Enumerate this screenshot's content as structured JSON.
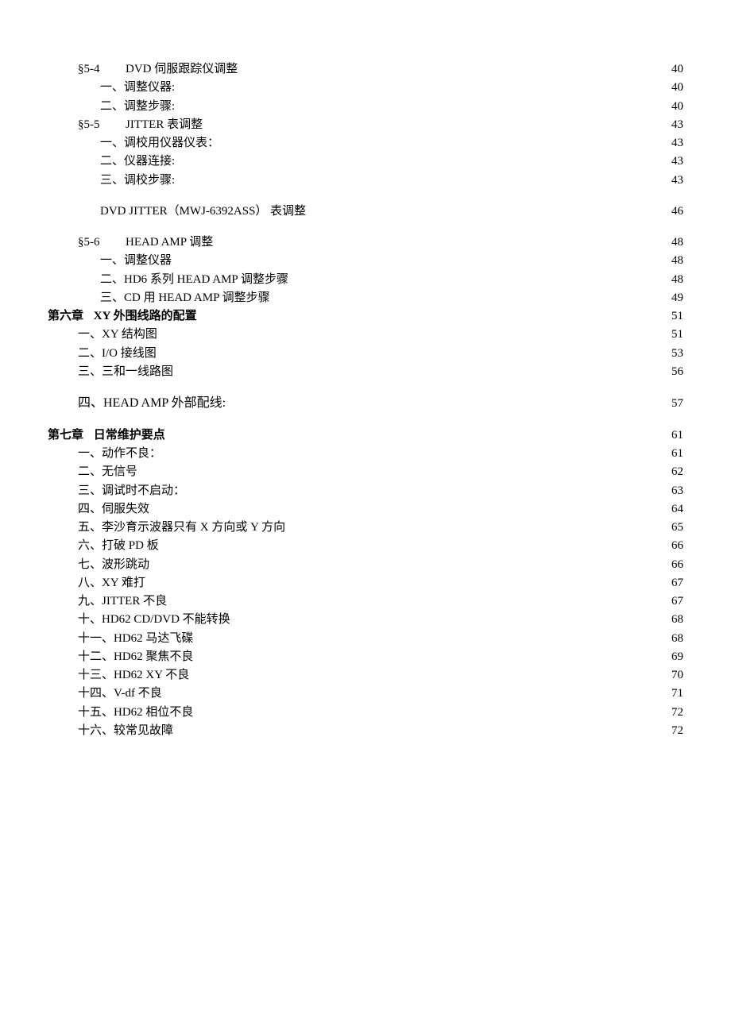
{
  "toc": {
    "entries": [
      {
        "level": "section",
        "section_num": "§5-4",
        "title": "DVD 伺服跟踪仪调整",
        "page": "40"
      },
      {
        "level": "sub1",
        "title": "一、调整仪器:",
        "page": "40"
      },
      {
        "level": "sub1",
        "title": "二、调整步骤:",
        "page": "40"
      },
      {
        "level": "section",
        "section_num": "§5-5",
        "title": "JITTER 表调整",
        "page": "43"
      },
      {
        "level": "sub1",
        "title": "一、调校用仪器仪表：",
        "page": "43"
      },
      {
        "level": "sub1",
        "title": "二、仪器连接:",
        "page": "43"
      },
      {
        "level": "sub1",
        "title": "三、调校步骤:",
        "page": "43"
      },
      {
        "level": "sub1",
        "gap": true,
        "title": "DVD JITTER（MWJ-6392ASS） 表调整",
        "page": "46"
      },
      {
        "level": "section",
        "gap": true,
        "section_num": "§5-6",
        "title": "HEAD AMP 调整",
        "page": "48"
      },
      {
        "level": "sub1",
        "title": "一、调整仪器",
        "page": "48"
      },
      {
        "level": "sub1",
        "title": "二、HD6 系列 HEAD AMP 调整步骤",
        "page": "48"
      },
      {
        "level": "sub1",
        "title": "三、CD  用 HEAD AMP 调整步骤",
        "page": "49"
      },
      {
        "level": "chapter",
        "chapter_num": "第六章",
        "title": "XY 外围线路的配置",
        "page": "51"
      },
      {
        "level": "sub2",
        "title": "一、XY 结构图",
        "page": "51"
      },
      {
        "level": "sub2",
        "title": "二、I/O 接线图",
        "page": "53"
      },
      {
        "level": "sub2",
        "title": "三、三和一线路图",
        "page": "56"
      },
      {
        "level": "sub2",
        "gap": true,
        "bigger": true,
        "title": "四、HEAD AMP 外部配线:",
        "page": "57"
      },
      {
        "level": "chapter",
        "gap": true,
        "chapter_num": "第七章",
        "title": "日常维护要点",
        "page": "61"
      },
      {
        "level": "sub2",
        "title": "一、动作不良：",
        "page": "61"
      },
      {
        "level": "sub2",
        "title": "二、无信号",
        "page": "62"
      },
      {
        "level": "sub2",
        "title": "三、调试时不启动：",
        "page": "63"
      },
      {
        "level": "sub2",
        "title": "四、伺服失效",
        "page": "64"
      },
      {
        "level": "sub2",
        "title": "五、李沙育示波器只有 X 方向或 Y 方向",
        "page": "65"
      },
      {
        "level": "sub2",
        "title": "六、打破 PD 板",
        "page": "66"
      },
      {
        "level": "sub2",
        "title": "七、波形跳动",
        "page": "66"
      },
      {
        "level": "sub2",
        "title": "八、XY 难打",
        "page": "67"
      },
      {
        "level": "sub2",
        "title": "九、JITTER  不良",
        "page": "67"
      },
      {
        "level": "sub2",
        "title": "十、HD62 CD/DVD  不能转换",
        "page": "68"
      },
      {
        "level": "sub2",
        "title": "十一、HD62 马达飞碟",
        "page": "68"
      },
      {
        "level": "sub2",
        "title": "十二、HD62  聚焦不良",
        "page": "69"
      },
      {
        "level": "sub2",
        "title": "十三、HD62 XY 不良",
        "page": "70"
      },
      {
        "level": "sub2",
        "title": "十四、V-df 不良",
        "page": "71"
      },
      {
        "level": "sub2",
        "title": "十五、HD62 相位不良",
        "page": "72"
      },
      {
        "level": "sub2",
        "title": "十六、较常见故障",
        "page": "72"
      }
    ]
  }
}
